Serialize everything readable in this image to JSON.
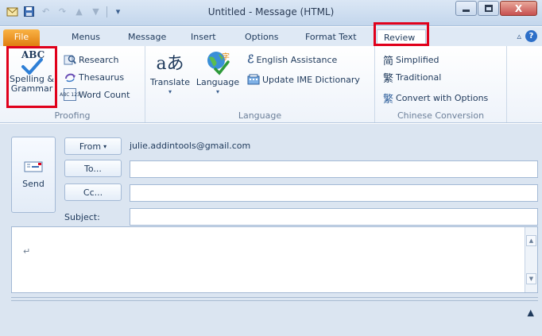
{
  "window": {
    "title": "Untitled  -  Message (HTML)",
    "close_glyph": "X"
  },
  "tabs": [
    "File",
    "Menus",
    "Message",
    "Insert",
    "Options",
    "Format Text",
    "Review"
  ],
  "active_tab": "Review",
  "ribbon": {
    "proofing": {
      "label": "Proofing",
      "spelling_line1": "Spelling &",
      "spelling_line2": "Grammar",
      "spelling_icon_text": "ABC",
      "research": "Research",
      "thesaurus": "Thesaurus",
      "word_count": "Word Count",
      "word_count_icon_text": "ABC 123"
    },
    "language": {
      "label": "Language",
      "translate": "Translate",
      "language_btn": "Language",
      "english_assistance": "English Assistance",
      "update_ime": "Update IME Dictionary"
    },
    "chinese": {
      "label": "Chinese Conversion",
      "simplified": "Simplified",
      "traditional": "Traditional",
      "convert": "Convert with Options",
      "simplified_glyph": "简",
      "traditional_glyph": "繁",
      "convert_glyph": "繁"
    }
  },
  "message": {
    "send": "Send",
    "from_label": "From",
    "from_value": "julie.addintools@gmail.com",
    "to_label": "To...",
    "cc_label": "Cc...",
    "subject_label": "Subject:",
    "to_value": "",
    "cc_value": "",
    "subject_value": "",
    "body_mark": "↵"
  },
  "colors": {
    "highlight": "#e0001b",
    "file_tab": "#e07e10",
    "accent": "#2d6fc8"
  },
  "icons": [
    "app-icon",
    "save-icon",
    "undo-icon",
    "redo-icon",
    "arrow-up-icon",
    "arrow-down-icon",
    "customize-qat-icon",
    "minimize-icon",
    "maximize-icon",
    "close-icon",
    "collapse-ribbon-icon",
    "help-icon",
    "spelling-icon",
    "research-icon",
    "thesaurus-icon",
    "word-count-icon",
    "translate-icon",
    "language-icon",
    "english-assistance-icon",
    "update-ime-icon",
    "simplified-icon",
    "traditional-icon",
    "convert-icon",
    "send-icon",
    "dropdown-arrow-icon",
    "scroll-up-icon",
    "scroll-down-icon",
    "expand-icon"
  ]
}
